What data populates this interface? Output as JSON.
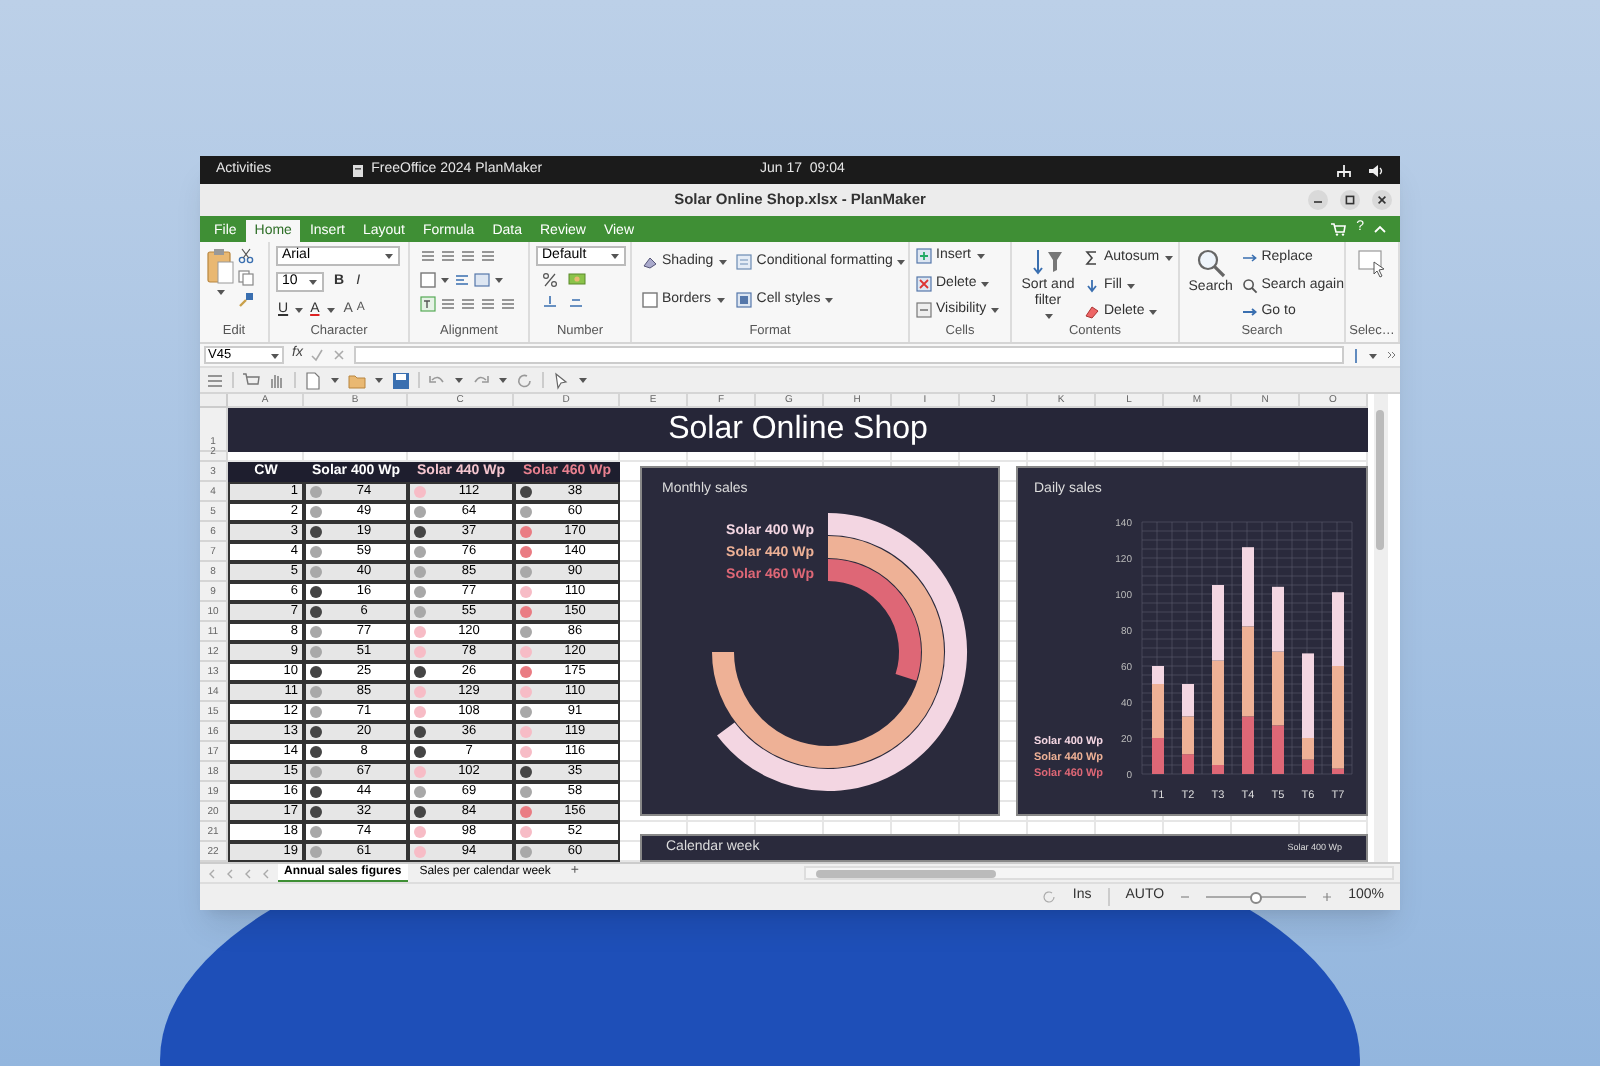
{
  "top_bar": {
    "activities": "Activities",
    "app": "FreeOffice 2024 PlanMaker",
    "clock": "Jun 17  09:04"
  },
  "window": {
    "title": "Solar Online Shop.xlsx - PlanMaker"
  },
  "ribbon_tabs": [
    {
      "label": "File",
      "selected": false
    },
    {
      "label": "Home",
      "selected": true
    },
    {
      "label": "Insert",
      "selected": false
    },
    {
      "label": "Layout",
      "selected": false
    },
    {
      "label": "Formula",
      "selected": false
    },
    {
      "label": "Data",
      "selected": false
    },
    {
      "label": "Review",
      "selected": false
    },
    {
      "label": "View",
      "selected": false
    }
  ],
  "help": "?",
  "ribbon": {
    "groups": [
      {
        "kind": "edit",
        "label": "Edit"
      },
      {
        "kind": "character",
        "label": "Character",
        "font": "Arial",
        "size": "10",
        "style_buttons": [
          "B",
          "I",
          "U",
          "A",
          "A",
          "A"
        ]
      },
      {
        "kind": "alignment",
        "label": "Alignment"
      },
      {
        "kind": "number",
        "label": "Number",
        "format": "Default"
      },
      {
        "kind": "grid",
        "label": "Format",
        "buttons": [
          "Shading",
          "Conditional formatting",
          "Borders",
          "Cell styles"
        ]
      },
      {
        "kind": "list",
        "label": "Cells",
        "buttons": [
          "Insert",
          "Delete",
          "Visibility"
        ]
      },
      {
        "kind": "contents",
        "label": "Contents",
        "big": "Sort and filter",
        "buttons": [
          "Autosum",
          "Fill",
          "Delete"
        ]
      },
      {
        "kind": "search",
        "label": "Search",
        "big": "Search",
        "buttons": [
          "Replace",
          "Search again",
          "Go to"
        ]
      },
      {
        "kind": "select",
        "label": "Selec…"
      }
    ]
  },
  "formula_bar": {
    "cell": "V45",
    "fx": "fx"
  },
  "sheet": {
    "title": "Solar Online Shop",
    "columns": [
      "A",
      "B",
      "C",
      "D",
      "E",
      "F",
      "G",
      "H",
      "I",
      "J",
      "K",
      "L",
      "M",
      "N",
      "O"
    ],
    "row_numbers": [
      "1",
      "2",
      "3",
      "4",
      "5",
      "6",
      "7",
      "8",
      "9",
      "10",
      "11",
      "12",
      "13",
      "14",
      "15",
      "16",
      "17",
      "18",
      "19",
      "20",
      "21",
      "22"
    ],
    "table_header": [
      "CW",
      "Solar 400 Wp",
      "Solar 440 Wp",
      "Solar 460 Wp"
    ],
    "rows": [
      {
        "cw": "1",
        "cells": [
          {
            "color": "#a8a8a8",
            "value": "74"
          },
          {
            "color": "#f7bcc6",
            "value": "112"
          },
          {
            "color": "#454545",
            "value": "38"
          }
        ]
      },
      {
        "cw": "2",
        "cells": [
          {
            "color": "#a8a8a8",
            "value": "49"
          },
          {
            "color": "#a8a8a8",
            "value": "64"
          },
          {
            "color": "#a8a8a8",
            "value": "60"
          }
        ]
      },
      {
        "cw": "3",
        "cells": [
          {
            "color": "#454545",
            "value": "19"
          },
          {
            "color": "#454545",
            "value": "37"
          },
          {
            "color": "#ea7c83",
            "value": "170"
          }
        ]
      },
      {
        "cw": "4",
        "cells": [
          {
            "color": "#a8a8a8",
            "value": "59"
          },
          {
            "color": "#a8a8a8",
            "value": "76"
          },
          {
            "color": "#ea7c83",
            "value": "140"
          }
        ]
      },
      {
        "cw": "5",
        "cells": [
          {
            "color": "#a8a8a8",
            "value": "40"
          },
          {
            "color": "#a8a8a8",
            "value": "85"
          },
          {
            "color": "#a8a8a8",
            "value": "90"
          }
        ]
      },
      {
        "cw": "6",
        "cells": [
          {
            "color": "#454545",
            "value": "16"
          },
          {
            "color": "#a8a8a8",
            "value": "77"
          },
          {
            "color": "#f7bcc6",
            "value": "110"
          }
        ]
      },
      {
        "cw": "7",
        "cells": [
          {
            "color": "#454545",
            "value": "6"
          },
          {
            "color": "#a8a8a8",
            "value": "55"
          },
          {
            "color": "#ea7c83",
            "value": "150"
          }
        ]
      },
      {
        "cw": "8",
        "cells": [
          {
            "color": "#a8a8a8",
            "value": "77"
          },
          {
            "color": "#f7bcc6",
            "value": "120"
          },
          {
            "color": "#a8a8a8",
            "value": "86"
          }
        ]
      },
      {
        "cw": "9",
        "cells": [
          {
            "color": "#a8a8a8",
            "value": "51"
          },
          {
            "color": "#f7bcc6",
            "value": "78"
          },
          {
            "color": "#f7bcc6",
            "value": "120"
          }
        ]
      },
      {
        "cw": "10",
        "cells": [
          {
            "color": "#454545",
            "value": "25"
          },
          {
            "color": "#454545",
            "value": "26"
          },
          {
            "color": "#ea7c83",
            "value": "175"
          }
        ]
      },
      {
        "cw": "11",
        "cells": [
          {
            "color": "#a8a8a8",
            "value": "85"
          },
          {
            "color": "#f7bcc6",
            "value": "129"
          },
          {
            "color": "#f7bcc6",
            "value": "110"
          }
        ]
      },
      {
        "cw": "12",
        "cells": [
          {
            "color": "#a8a8a8",
            "value": "71"
          },
          {
            "color": "#f7bcc6",
            "value": "108"
          },
          {
            "color": "#a8a8a8",
            "value": "91"
          }
        ]
      },
      {
        "cw": "13",
        "cells": [
          {
            "color": "#454545",
            "value": "20"
          },
          {
            "color": "#454545",
            "value": "36"
          },
          {
            "color": "#f7bcc6",
            "value": "119"
          }
        ]
      },
      {
        "cw": "14",
        "cells": [
          {
            "color": "#454545",
            "value": "8"
          },
          {
            "color": "#454545",
            "value": "7"
          },
          {
            "color": "#f7bcc6",
            "value": "116"
          }
        ]
      },
      {
        "cw": "15",
        "cells": [
          {
            "color": "#a8a8a8",
            "value": "67"
          },
          {
            "color": "#f7bcc6",
            "value": "102"
          },
          {
            "color": "#454545",
            "value": "35"
          }
        ]
      },
      {
        "cw": "16",
        "cells": [
          {
            "color": "#454545",
            "value": "44"
          },
          {
            "color": "#a8a8a8",
            "value": "69"
          },
          {
            "color": "#a8a8a8",
            "value": "58"
          }
        ]
      },
      {
        "cw": "17",
        "cells": [
          {
            "color": "#454545",
            "value": "32"
          },
          {
            "color": "#454545",
            "value": "84"
          },
          {
            "color": "#ea7c83",
            "value": "156"
          }
        ]
      },
      {
        "cw": "18",
        "cells": [
          {
            "color": "#a8a8a8",
            "value": "74"
          },
          {
            "color": "#f7bcc6",
            "value": "98"
          },
          {
            "color": "#f7bcc6",
            "value": "52"
          }
        ]
      },
      {
        "cw": "19",
        "cells": [
          {
            "color": "#a8a8a8",
            "value": "61"
          },
          {
            "color": "#f7bcc6",
            "value": "94"
          },
          {
            "color": "#a8a8a8",
            "value": "60"
          }
        ]
      }
    ]
  },
  "monthly_sales": {
    "title": "Monthly sales",
    "legend": [
      {
        "label": "Solar 400 Wp",
        "color": "#f3d6e2"
      },
      {
        "label": "Solar 440 Wp",
        "color": "#eeb196"
      },
      {
        "label": "Solar 460 Wp",
        "color": "#de6776"
      }
    ]
  },
  "daily_sales": {
    "chart_data": {
      "type": "bar",
      "title": "Daily sales",
      "stacked": true,
      "grid": true,
      "categories": [
        "T1",
        "T2",
        "T3",
        "T4",
        "T5",
        "T6",
        "T7"
      ],
      "ylim": [
        0,
        140
      ],
      "yticks": [
        0,
        20,
        40,
        60,
        80,
        100,
        120,
        140
      ],
      "series": [
        {
          "name": "Solar 400 Wp",
          "color": "#f3d6e2",
          "values": [
            10,
            18,
            42,
            44,
            36,
            47,
            41
          ]
        },
        {
          "name": "Solar 440 Wp",
          "color": "#eeb196",
          "values": [
            30,
            21,
            58,
            50,
            41,
            12,
            57
          ]
        },
        {
          "name": "Solar 460 Wp",
          "color": "#de6776",
          "values": [
            20,
            11,
            5,
            32,
            27,
            8,
            3
          ]
        }
      ]
    }
  },
  "calendar_week": {
    "title": "Calendar week",
    "legend": "Solar 400 Wp"
  },
  "sheet_tabs": [
    {
      "label": "Annual sales figures",
      "selected": true
    },
    {
      "label": "Sales per calendar week",
      "selected": false
    }
  ],
  "add_sheet": "+",
  "status_bar": {
    "mode": "Ins",
    "calc": "AUTO",
    "zoom": "100%",
    "zoom_level": {
      "level": 0.5
    }
  }
}
